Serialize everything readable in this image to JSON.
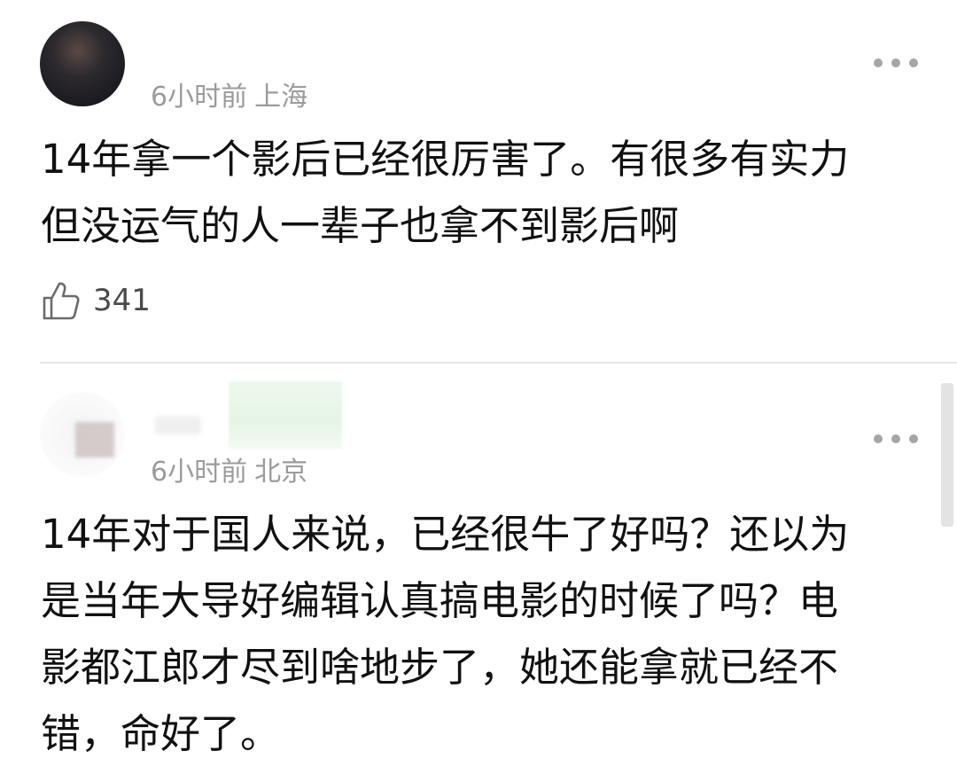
{
  "comments": [
    {
      "time": "6小时前",
      "location": "上海",
      "text_lines": [
        "14年拿一个影后已经很厉害了。有很多有实力",
        "但没运气的人一辈子也拿不到影后啊"
      ],
      "likes": "341",
      "icons": {
        "more": "more-dots-icon",
        "like": "thumbs-up-icon"
      }
    },
    {
      "time": "6小时前",
      "location": "北京",
      "text_lines": [
        "14年对于国人来说，已经很牛了好吗？还以为",
        "是当年大导好编辑认真搞电影的时候了吗？电",
        "影都江郎才尽到啥地步了，她还能拿就已经不",
        "错，命好了。"
      ],
      "icons": {
        "more": "more-dots-icon"
      }
    }
  ],
  "colors": {
    "text": "#111111",
    "meta": "#9b9b9b",
    "divider": "#e4e4e4",
    "icon": "#a6a6a6"
  }
}
